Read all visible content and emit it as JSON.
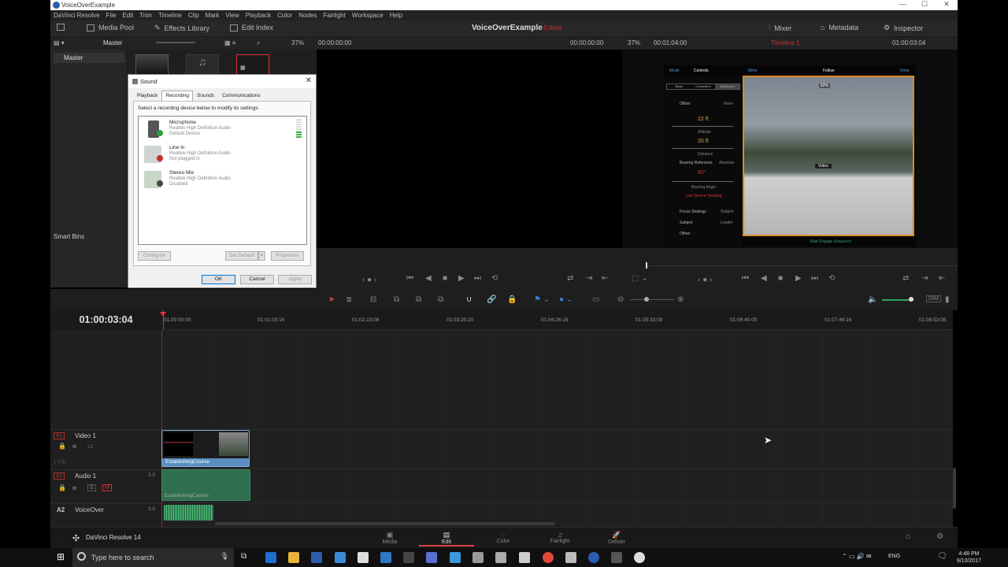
{
  "window": {
    "title": "VoiceOverExample",
    "controls": [
      "—",
      "☐",
      "✕"
    ]
  },
  "menu": [
    "DaVinci Resolve",
    "File",
    "Edit",
    "Trim",
    "Timeline",
    "Clip",
    "Mark",
    "View",
    "Playback",
    "Color",
    "Nodes",
    "Fairlight",
    "Workspace",
    "Help"
  ],
  "toolbar": {
    "media_pool": "Media Pool",
    "effects_library": "Effects Library",
    "edit_index": "Edit Index",
    "project_title": "VoiceOverExample",
    "project_status": "Edited",
    "mixer": "Mixer",
    "metadata": "Metadata",
    "inspector": "Inspector"
  },
  "viewer_header": {
    "bin_name": "Master",
    "source_zoom": "37%",
    "source_tc_in": "00:00:00:00",
    "source_tc_out": "00:00:00:00",
    "timeline_zoom": "37%",
    "timeline_duration": "00:01:04:00",
    "timeline_name": "Timeline 1",
    "timeline_tc": "01:00:03:04"
  },
  "media_pool": {
    "master": "Master",
    "smart_bins": "Smart Bins"
  },
  "sound_dialog": {
    "title": "Sound",
    "tabs": [
      "Playback",
      "Recording",
      "Sounds",
      "Communications"
    ],
    "instruction": "Select a recording device below to modify its settings:",
    "devices": [
      {
        "name": "Microphone",
        "driver": "Realtek High Definition Audio",
        "status": "Default Device"
      },
      {
        "name": "Line In",
        "driver": "Realtek High Definition Audio",
        "status": "Not plugged in"
      },
      {
        "name": "Stereo Mix",
        "driver": "Realtek High Definition Audio",
        "status": "Disabled"
      }
    ],
    "configure": "Configure",
    "set_default": "Set Default",
    "properties": "Properties",
    "ok": "OK",
    "cancel": "Cancel",
    "apply": "Apply"
  },
  "phone_ui": {
    "top": [
      "Mode",
      "Controls",
      "More",
      "Follow",
      "Done"
    ],
    "segments": [
      "Basic",
      "Controllers",
      "Advanced"
    ],
    "offset": "Offset",
    "offset_value": "None",
    "altitude": "22 ft",
    "altitude_label": "Altitude",
    "distance": "20 ft",
    "distance_label": "Distance",
    "bearing_ref": "Bearing Reference",
    "bearing_ref_value": "Absolute",
    "bearing": "60°",
    "bearing_label": "Bearing Angle",
    "heading": "Use Device Heading",
    "focus_strategy": "Focus Strategy",
    "focus_strategy_value": "Subject",
    "subject": "Subject",
    "subject_value": "Leader",
    "offset2": "Offset",
    "start": "Start Engage Sequence",
    "video_label": "Video",
    "battery": "82%"
  },
  "timeline": {
    "timecode": "01:00:03:04",
    "ruler": [
      "01:00:00:00",
      "01:01:03:16",
      "01:02:13:08",
      "01:03:20:20",
      "01:04:26:16",
      "01:05:33:08",
      "01:06:40:00",
      "01:07:46:16",
      "01:08:53:08"
    ],
    "tracks": {
      "v1": {
        "badge": "V1",
        "name": "Video 1",
        "sub": "1 Clip"
      },
      "a1": {
        "badge": "A1",
        "name": "Audio 1",
        "ch": "2.0"
      },
      "a2": {
        "badge": "A2",
        "name": "VoiceOver",
        "ch": "2.0"
      }
    },
    "clip_video": "EstablishingCourse",
    "clip_audio": "EstablishingCourse"
  },
  "pages": {
    "app_name": "DaVinci Resolve 14",
    "items": [
      "Media",
      "Edit",
      "Color",
      "Fairlight",
      "Deliver"
    ]
  },
  "taskbar": {
    "search_placeholder": "Type here to search",
    "lang": "ENG",
    "time": "4:48 PM",
    "date": "9/10/2017"
  },
  "colors": {
    "accent_red": "#d44444",
    "clip_blue": "#5a8fbf",
    "clip_green": "#2f6e4f"
  }
}
